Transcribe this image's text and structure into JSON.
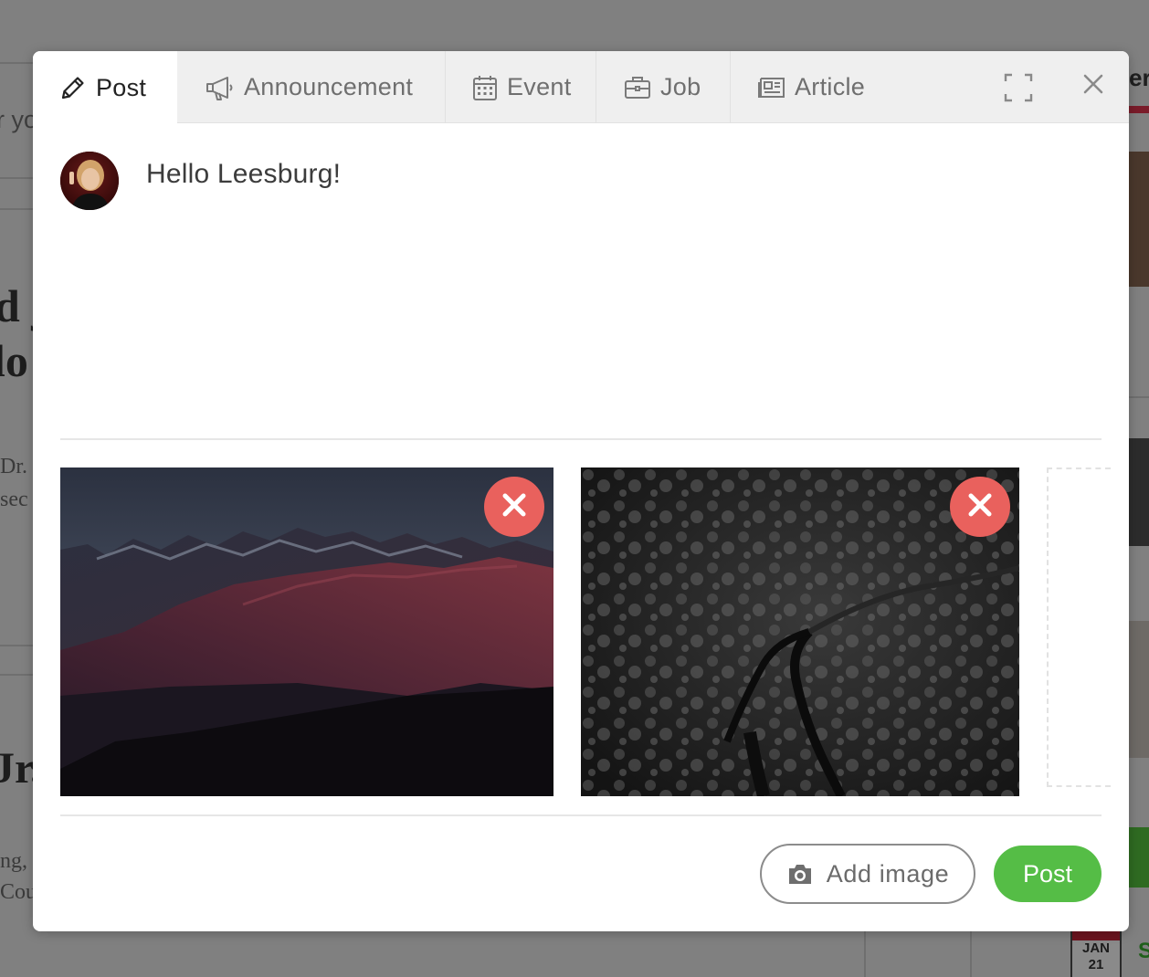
{
  "background": {
    "fragments": [
      "r yo",
      "d j",
      "lo",
      "Dr.",
      "sec",
      "Jr.",
      "ng,",
      "Cou",
      "er"
    ],
    "calendar": {
      "month": "JAN",
      "day": "21"
    },
    "green_letter": "S"
  },
  "tabs": [
    {
      "label": "Post",
      "icon": "pencil-icon",
      "active": true
    },
    {
      "label": "Announcement",
      "icon": "megaphone-icon",
      "active": false
    },
    {
      "label": "Event",
      "icon": "calendar-icon",
      "active": false
    },
    {
      "label": "Job",
      "icon": "briefcase-icon",
      "active": false
    },
    {
      "label": "Article",
      "icon": "newspaper-icon",
      "active": false
    }
  ],
  "header_icons": {
    "expand": "expand-icon",
    "close": "close-icon"
  },
  "composer": {
    "text": "Hello Leesburg!",
    "avatar_icon": "user-avatar"
  },
  "attachments": [
    {
      "description_icon": "mountain-photo",
      "remove_icon": "remove-icon"
    },
    {
      "description_icon": "forest-aerial-photo",
      "remove_icon": "remove-icon"
    }
  ],
  "actions": {
    "add_image_label": "Add image",
    "add_image_icon": "camera-icon",
    "post_label": "Post"
  },
  "colors": {
    "post_button": "#55bd46",
    "remove_button": "#e9615d",
    "tab_bar": "#efefef"
  }
}
